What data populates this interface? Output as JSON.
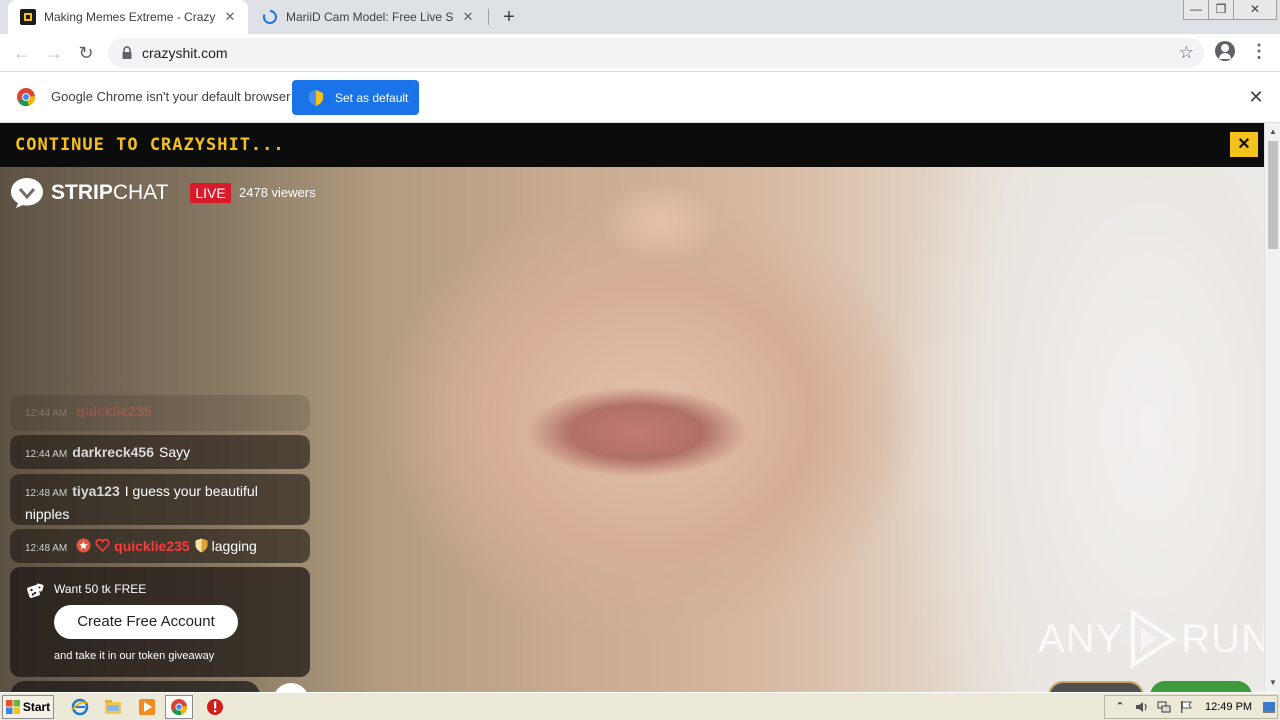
{
  "browser": {
    "tabs": [
      {
        "title": "Making Memes Extreme - Crazy Shit",
        "active": true
      },
      {
        "title": "MariiD Cam Model: Free Live Sex Sho",
        "active": false,
        "loading": true
      }
    ],
    "new_tab_label": "+",
    "url": "crazyshit.com",
    "window_controls": {
      "minimize": "—",
      "restore": "❐",
      "close": "✕"
    },
    "infobar": {
      "message": "Google Chrome isn't your default browser",
      "button_label": "Set as default",
      "close": "✕"
    }
  },
  "page": {
    "promo_banner": "CONTINUE TO CRAZYSHIT...",
    "promo_close": "✕",
    "brand_strip": "STRIP",
    "brand_chat": "CHAT",
    "live_label": "LIVE",
    "viewers": "2478 viewers",
    "chat": [
      {
        "time": "12:44 AM",
        "user": "quicklie235",
        "text": "",
        "faded": true
      },
      {
        "time": "12:44 AM",
        "user": "darkreck456",
        "text": "Sayy"
      },
      {
        "time": "12:48 AM",
        "user": "tiya123",
        "text": "I guess your beautiful nipples"
      },
      {
        "time": "12:48 AM",
        "user": "quicklie235",
        "text": "lagging"
      }
    ],
    "promo_card": {
      "headline": "Want 50 tk FREE",
      "button_label": "Create Free Account",
      "subtext": "and take it in our token giveaway"
    },
    "watermark_left": "ANY",
    "watermark_right": "RUN"
  },
  "taskbar": {
    "start_label": "Start",
    "clock": "12:49 PM"
  },
  "colors": {
    "promo_yellow": "#f4c21b",
    "live_red": "#d91a2a",
    "chrome_blue": "#1a73e8",
    "chat_name_red": "#ff3a3a"
  }
}
